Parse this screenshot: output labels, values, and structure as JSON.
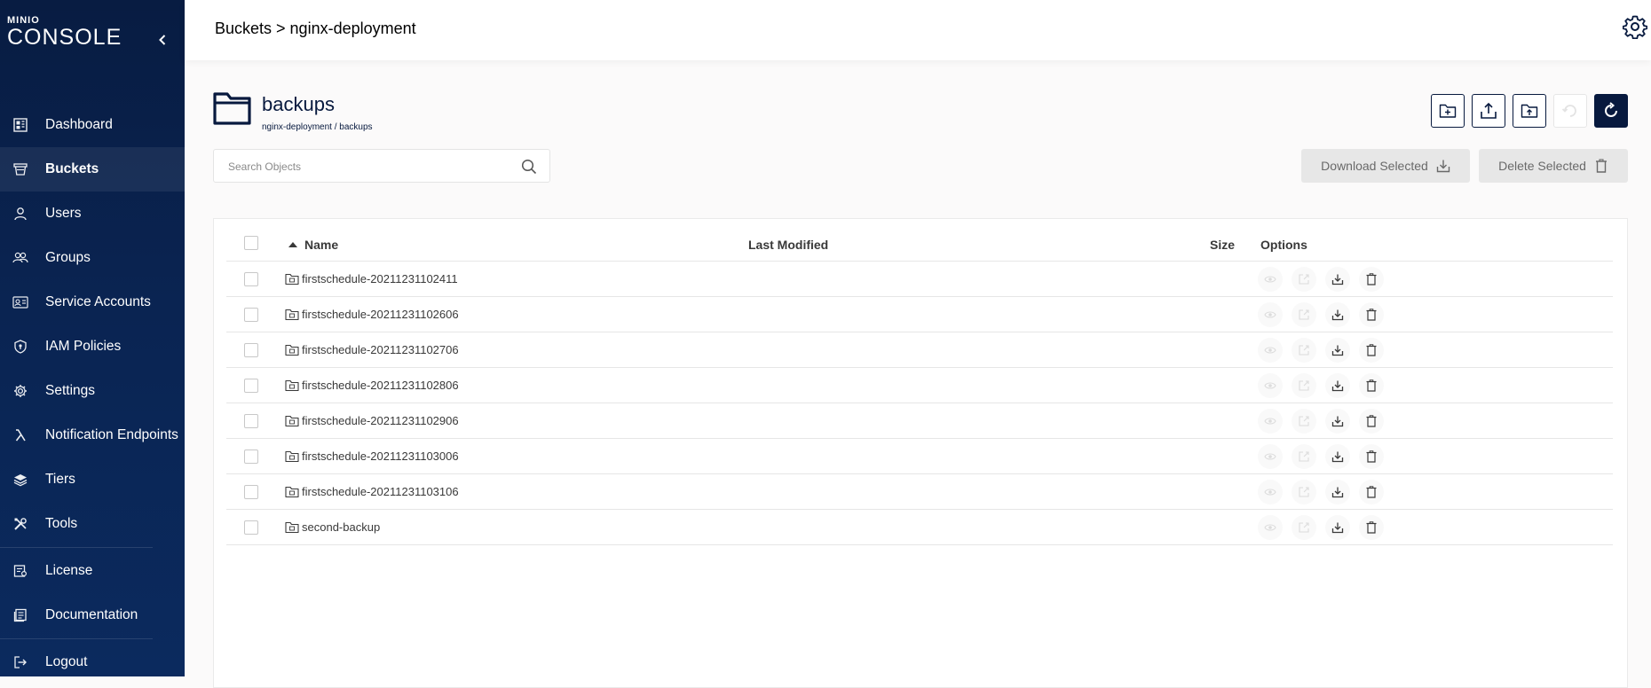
{
  "brand": {
    "top": "MINIO",
    "main": "CONSOLE"
  },
  "header": {
    "breadcrumb": "Buckets > nginx-deployment"
  },
  "sidebar": {
    "items": [
      {
        "label": "Dashboard",
        "icon": "dashboard-icon",
        "active": false
      },
      {
        "label": "Buckets",
        "icon": "bucket-icon",
        "active": true
      },
      {
        "label": "Users",
        "icon": "user-icon",
        "active": false
      },
      {
        "label": "Groups",
        "icon": "groups-icon",
        "active": false
      },
      {
        "label": "Service Accounts",
        "icon": "service-accounts-icon",
        "active": false
      },
      {
        "label": "IAM Policies",
        "icon": "shield-icon",
        "active": false
      },
      {
        "label": "Settings",
        "icon": "gear-icon",
        "active": false
      },
      {
        "label": "Notification Endpoints",
        "icon": "lambda-icon",
        "active": false
      },
      {
        "label": "Tiers",
        "icon": "layers-icon",
        "active": false
      },
      {
        "label": "Tools",
        "icon": "tools-icon",
        "active": false
      },
      {
        "label": "License",
        "icon": "license-icon",
        "active": false
      },
      {
        "label": "Documentation",
        "icon": "documentation-icon",
        "active": false
      },
      {
        "label": "Logout",
        "icon": "logout-icon",
        "active": false
      }
    ]
  },
  "bucket": {
    "name": "backups",
    "path": "nginx-deployment / backups"
  },
  "search": {
    "placeholder": "Search Objects"
  },
  "actions": {
    "download": "Download Selected",
    "delete": "Delete Selected"
  },
  "table": {
    "headers": {
      "name": "Name",
      "last_modified": "Last Modified",
      "size": "Size",
      "options": "Options"
    },
    "rows": [
      {
        "name": "firstschedule-20211231102411"
      },
      {
        "name": "firstschedule-20211231102606"
      },
      {
        "name": "firstschedule-20211231102706"
      },
      {
        "name": "firstschedule-20211231102806"
      },
      {
        "name": "firstschedule-20211231102906"
      },
      {
        "name": "firstschedule-20211231103006"
      },
      {
        "name": "firstschedule-20211231103106"
      },
      {
        "name": "second-backup"
      }
    ]
  },
  "colors": {
    "navy": "#07193e",
    "sidebar": "#0a2452",
    "disabled_button": "#e7e7e7"
  }
}
